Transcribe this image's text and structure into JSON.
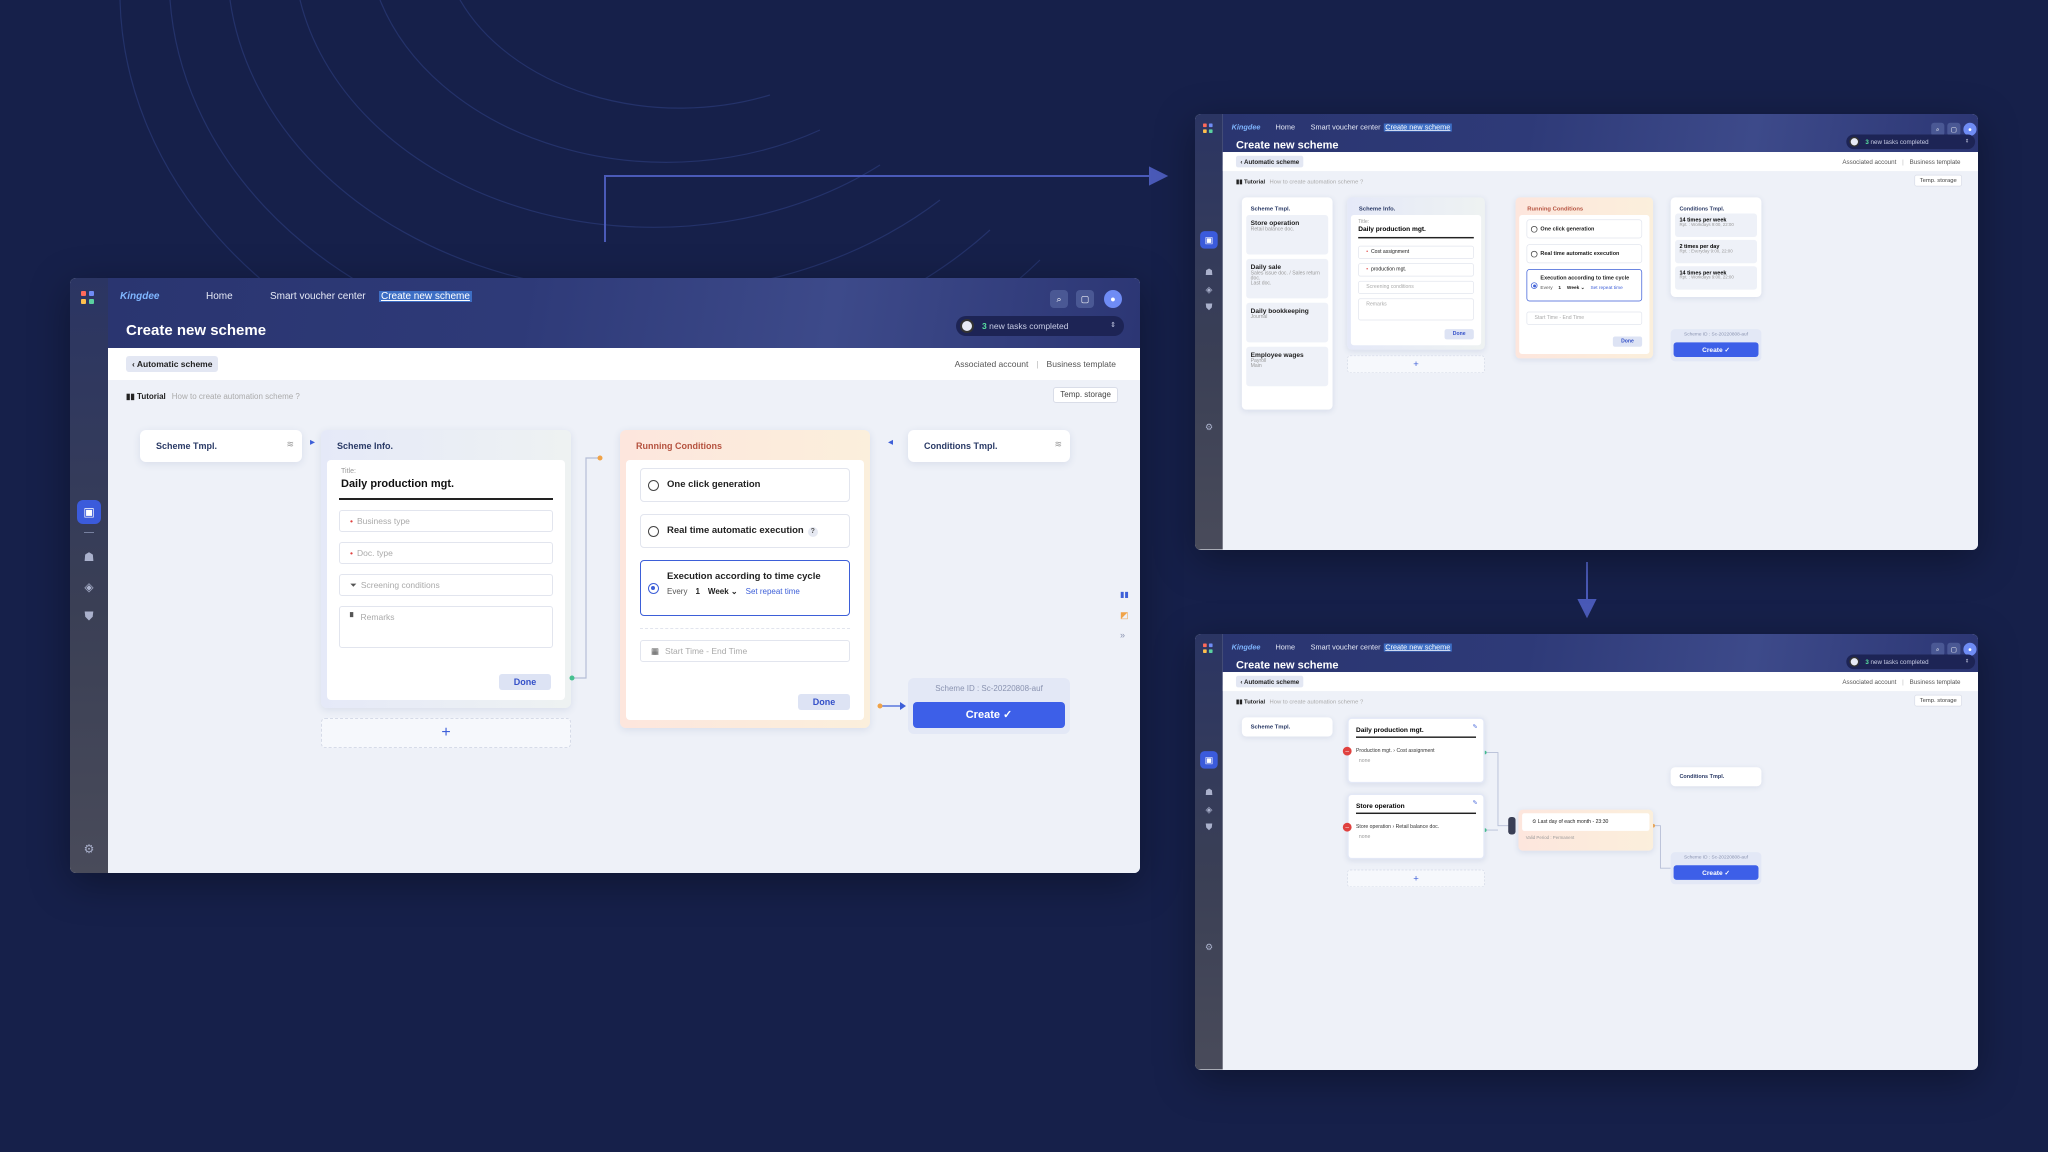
{
  "app": {
    "brand": "Kingdee",
    "nav": {
      "home": "Home",
      "smart": "Smart voucher center",
      "current": "Create new scheme"
    },
    "page_title": "Create new scheme",
    "tasks": {
      "count": "3",
      "text": "new tasks completed"
    },
    "tabs": {
      "automatic": "Automatic scheme",
      "associated": "Associated account",
      "business": "Business template"
    },
    "tutorial": {
      "label": "Tutorial",
      "hint": "How to create automation scheme ?"
    },
    "temp_storage": "Temp. storage"
  },
  "main": {
    "scheme_tmpl": "Scheme Tmpl.",
    "scheme_info": {
      "header": "Scheme Info.",
      "title_label": "Title:",
      "title_value": "Daily production mgt.",
      "business_type": "Business type",
      "doc_type": "Doc. type",
      "screening": "Screening conditions",
      "remarks": "Remarks",
      "done": "Done"
    },
    "running": {
      "header": "Running Conditions",
      "opt1": "One click generation",
      "opt2": "Real time automatic execution",
      "opt3": "Execution according to time cycle",
      "every": "Every",
      "num": "1",
      "week": "Week",
      "repeat": "Set repeat time",
      "time": "Start Time - End Time",
      "done": "Done"
    },
    "conditions_tmpl": "Conditions Tmpl.",
    "scheme_id": "Scheme ID : Sc-20220808-auf",
    "create": "Create"
  },
  "top": {
    "templates": [
      {
        "name": "Store operation",
        "sub": "Retail balance doc."
      },
      {
        "name": "Daily sale",
        "sub": "Sales issue doc. / Sales return doc."
      },
      {
        "name": "Daily bookkeeping",
        "sub": "Journal"
      },
      {
        "name": "Employee wages",
        "sub": "Payroll"
      }
    ],
    "template_extra": {
      "last_doc": "Last doc.",
      "main": "Main"
    },
    "info_fields": {
      "cost": "Cost assignment",
      "production": "production mgt."
    },
    "cond_tmpls": [
      {
        "name": "14 times per week",
        "sub": "Rpt. : Workdays  9:00, 22:00"
      },
      {
        "name": "2 times per day",
        "sub": "Rpt. : Everyday  9:00, 22:00"
      },
      {
        "name": "14 times per week",
        "sub": "Rpt. : Workdays  9:00, 22:00"
      }
    ]
  },
  "bottom": {
    "card1": {
      "title": "Daily production mgt.",
      "path_a": "Production mgt.",
      "path_b": "Cost assignment",
      "none": "none"
    },
    "card2": {
      "title": "Store operation",
      "path_a": "Store operation",
      "path_b": "Retail balance doc.",
      "none": "none"
    },
    "cond": {
      "text": "Last day of each month - 23:30",
      "sub": "Valid Period : Permanent"
    }
  }
}
